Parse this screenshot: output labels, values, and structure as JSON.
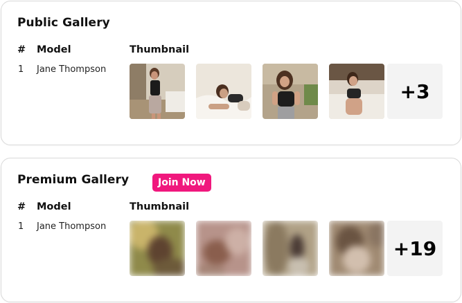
{
  "public": {
    "title": "Public Gallery",
    "headers": {
      "hash": "#",
      "model": "Model",
      "thumbnail": "Thumbnail"
    },
    "row": {
      "num": "1",
      "name": "Jane Thompson"
    },
    "more": "+3"
  },
  "premium": {
    "title": "Premium Gallery",
    "join": "Join Now",
    "headers": {
      "hash": "#",
      "model": "Model",
      "thumbnail": "Thumbnail"
    },
    "row": {
      "num": "1",
      "name": "Jane Thompson"
    },
    "more": "+19"
  },
  "colors": {
    "accent": "#f0187d",
    "tile": "#f3f3f3",
    "border": "#d9d9d9"
  }
}
